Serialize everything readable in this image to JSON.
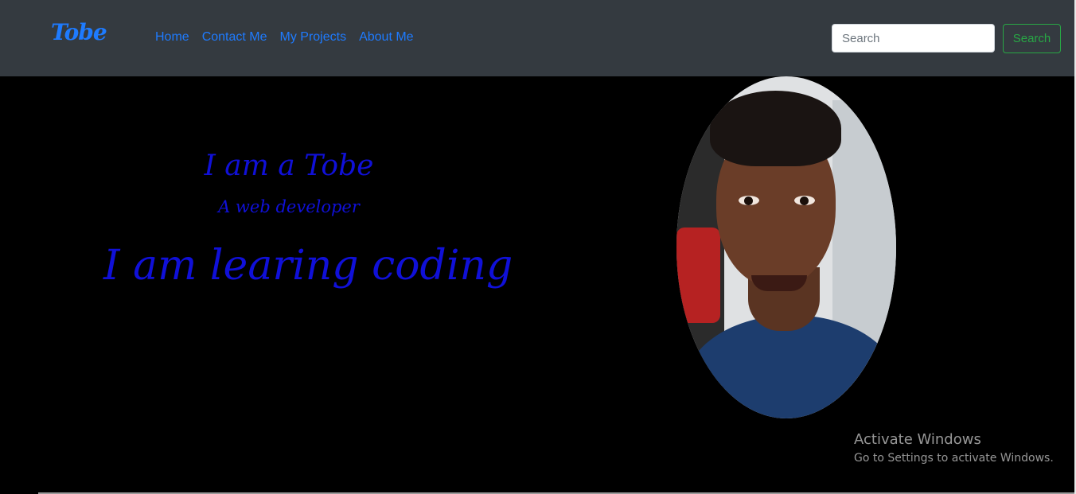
{
  "navbar": {
    "brand": "Tobe",
    "links": [
      "Home",
      "Contact Me",
      "My Projects",
      "About Me"
    ],
    "search": {
      "placeholder": "Search",
      "button_label": "Search"
    },
    "colors": {
      "background": "#343a40",
      "link": "#1e7bff",
      "search_button": "#28a745"
    }
  },
  "hero": {
    "line1": "I am a Tobe",
    "line2": "A web developer",
    "line3": "I am learing coding",
    "text_color": "#1010d8",
    "background": "#000000"
  },
  "watermark": {
    "title": "Activate Windows",
    "subtitle": "Go to Settings to activate Windows."
  }
}
